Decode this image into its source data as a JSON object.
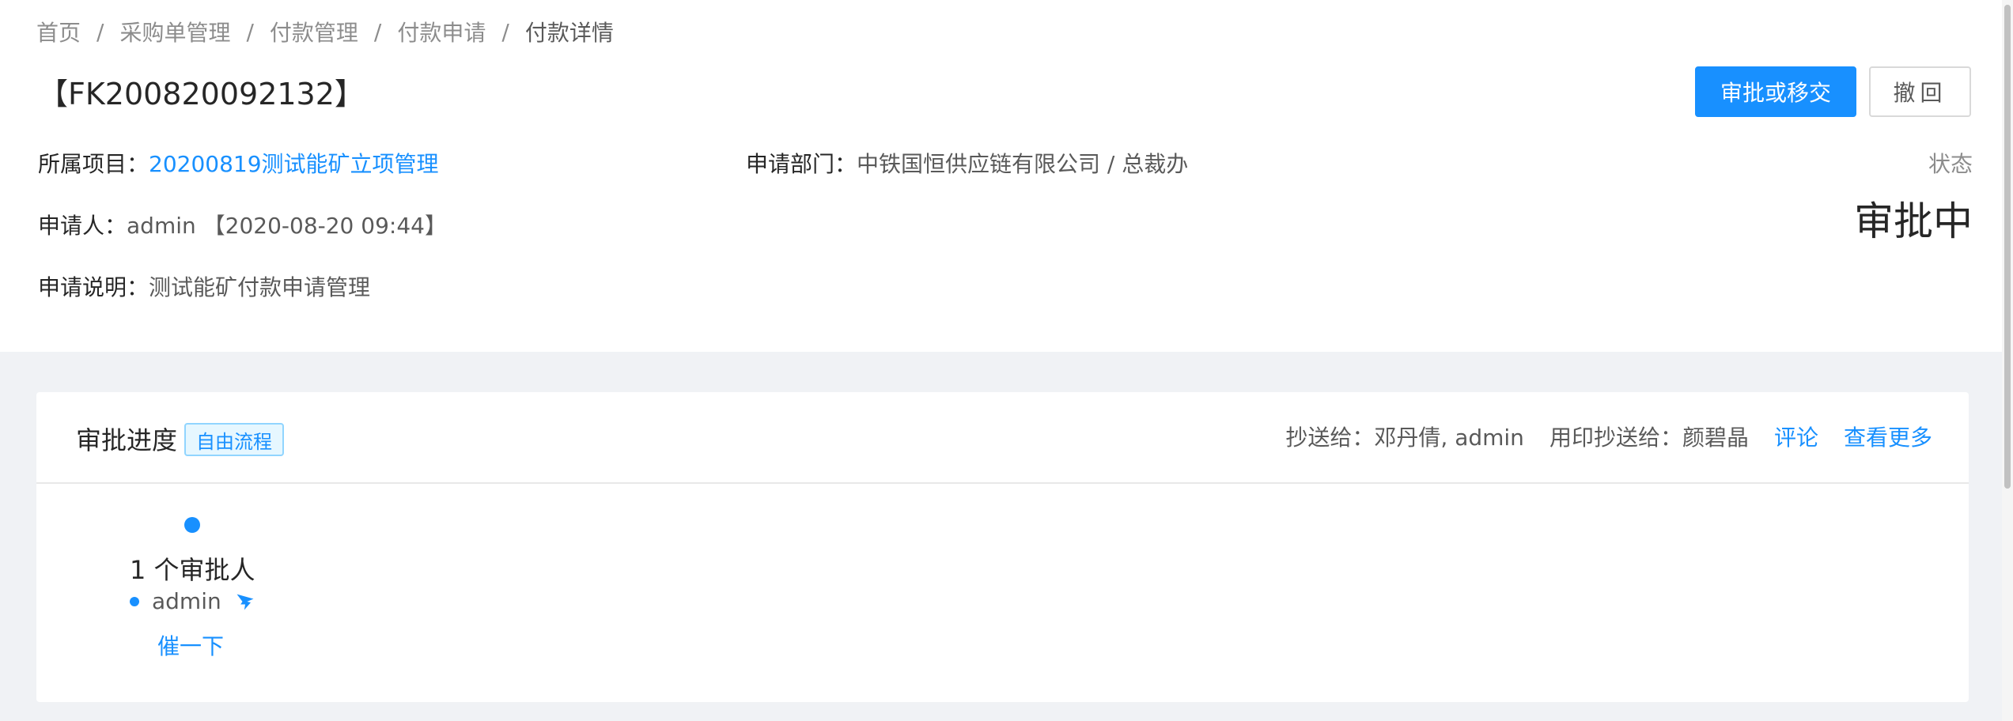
{
  "breadcrumb": {
    "items": [
      "首页",
      "采购单管理",
      "付款管理",
      "付款申请",
      "付款详情"
    ],
    "separator": "/"
  },
  "header": {
    "title": "【FK200820092132】",
    "approve_button": "审批或移交",
    "withdraw_button": "撤回"
  },
  "info": {
    "project_label": "所属项目：",
    "project_value": "20200819测试能矿立项管理",
    "dept_label": "申请部门：",
    "dept_value": "中铁国恒供应链有限公司 / 总裁办",
    "applicant_label": "申请人：",
    "applicant_value": "admin 【2020-08-20 09:44】",
    "desc_label": "申请说明：",
    "desc_value": "测试能矿付款申请管理"
  },
  "status": {
    "label": "状态",
    "value": "审批中"
  },
  "progress": {
    "title": "审批进度",
    "tag": "自由流程",
    "cc_label": "抄送给：",
    "cc_value": "邓丹倩, admin",
    "seal_cc_label": "用印抄送给：",
    "seal_cc_value": "颜碧晶",
    "comment_link": "评论",
    "more_link": "查看更多",
    "step_title": "1 个审批人",
    "approver_name": "admin",
    "approver_icon": "dingtalk-icon",
    "urge_link": "催一下"
  },
  "colors": {
    "primary": "#1890ff",
    "background": "#f0f2f5"
  }
}
